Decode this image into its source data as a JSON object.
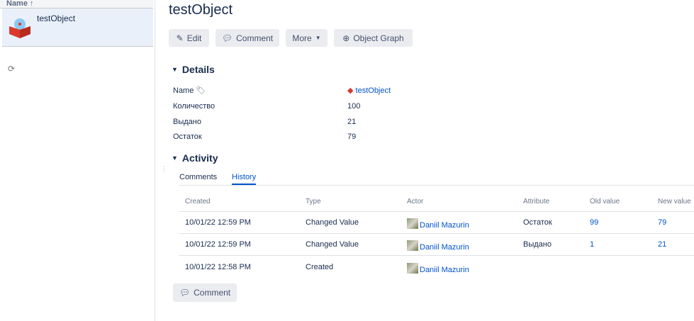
{
  "left_panel": {
    "column_header": "Name",
    "sort_icon": "arrow-up-icon",
    "item": "testObject",
    "refresh_icon": "refresh-icon"
  },
  "title": "testObject",
  "toolbar": {
    "edit": "Edit",
    "comment": "Comment",
    "more": "More",
    "graph": "Object Graph"
  },
  "details": {
    "heading": "Details",
    "rows": [
      {
        "label": "Name",
        "value": "testObject"
      },
      {
        "label": "Количество",
        "value": "100"
      },
      {
        "label": "Выдано",
        "value": "21"
      },
      {
        "label": "Остаток",
        "value": "79"
      }
    ]
  },
  "activity": {
    "heading": "Activity",
    "tabs": [
      "Comments",
      "History"
    ],
    "active_tab": "History",
    "columns": [
      "Created",
      "Type",
      "Actor",
      "Attribute",
      "Old value",
      "New value"
    ],
    "rows": [
      [
        "10/01/22 12:59 PM",
        "Changed Value",
        "Daniil Mazurin",
        "Остаток",
        "99",
        "79"
      ],
      [
        "10/01/22 12:59 PM",
        "Changed Value",
        "Daniil Mazurin",
        "Выдано",
        "1",
        "21"
      ],
      [
        "10/01/22 12:58 PM",
        "Created",
        "Daniil Mazurin",
        "",
        "",
        ""
      ]
    ],
    "comment_button": "Comment"
  }
}
